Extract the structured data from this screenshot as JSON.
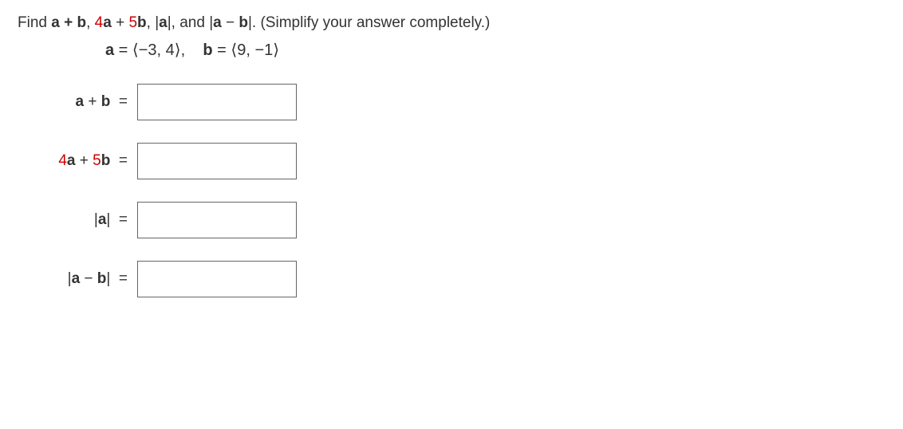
{
  "question": {
    "prefix": "Find  ",
    "part1": "a + b",
    "sep1": ", ",
    "part2_4": "4",
    "part2_a": "a",
    "part2_plus": " + ",
    "part2_5": "5",
    "part2_b": "b",
    "sep2": ", ",
    "part3": "|a|",
    "sep3": ", and ",
    "part4_open": "|",
    "part4_a": "a",
    "part4_minus": " − ",
    "part4_b": "b",
    "part4_close": "|",
    "suffix": ".  (Simplify your answer completely.)"
  },
  "definitions": {
    "a_label": "a",
    "a_eq": " = ",
    "a_val_open": "⟨",
    "a_v1": "−3, 4",
    "a_val_close": "⟩",
    "gap": ",    ",
    "b_label": "b",
    "b_eq": " = ",
    "b_val_open": "⟨",
    "b_v1": "9, −1",
    "b_val_close": "⟩"
  },
  "rows": {
    "r1": {
      "label_a": "a",
      "label_plus": " + ",
      "label_b": "b",
      "label_eq": "  ="
    },
    "r2": {
      "label_4": "4",
      "label_a": "a",
      "label_plus": " + ",
      "label_5": "5",
      "label_b": "b",
      "label_eq": "  ="
    },
    "r3": {
      "label_open": "|",
      "label_a": "a",
      "label_close": "|",
      "label_eq": "  ="
    },
    "r4": {
      "label_open": "|",
      "label_a": "a",
      "label_minus": " − ",
      "label_b": "b",
      "label_close": "|",
      "label_eq": "  ="
    }
  },
  "answers": {
    "r1": "",
    "r2": "",
    "r3": "",
    "r4": ""
  }
}
